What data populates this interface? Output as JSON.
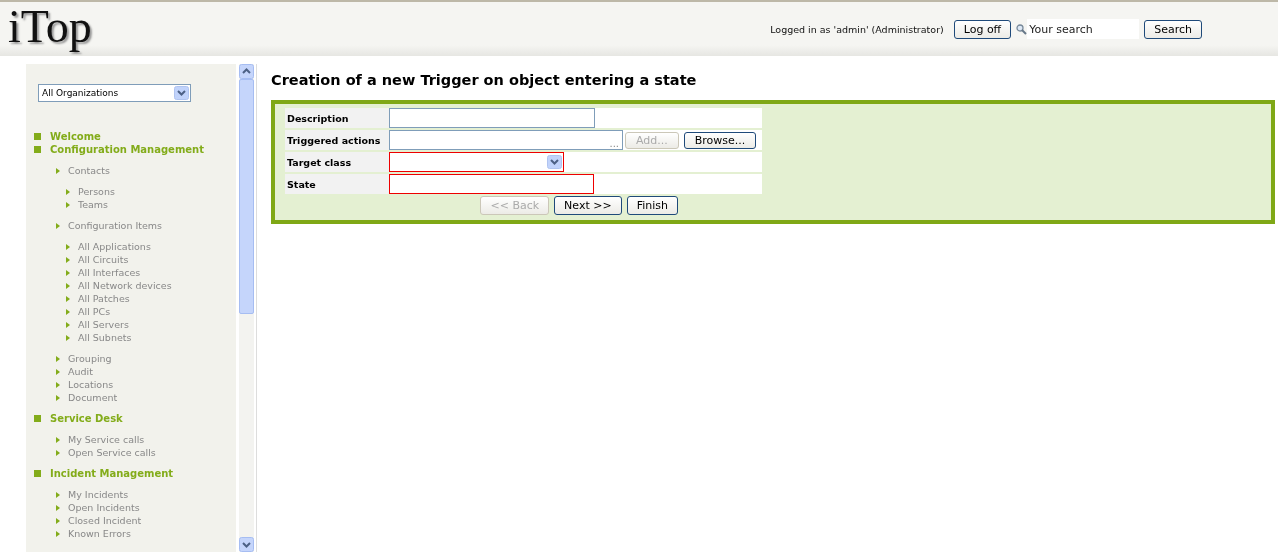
{
  "header": {
    "logo": "iTop",
    "login_text": "Logged in as 'admin' (Administrator)",
    "logoff_button": "Log off",
    "search": {
      "placeholder": "Your search"
    },
    "search_button": "Search"
  },
  "sidebar": {
    "organization_select": "All Organizations",
    "menu": [
      {
        "label": "Welcome"
      },
      {
        "label": "Configuration Management",
        "children": [
          {
            "label": "Contacts",
            "children": [
              {
                "label": "Persons"
              },
              {
                "label": "Teams"
              }
            ]
          },
          {
            "label": "Configuration Items",
            "children": [
              {
                "label": "All Applications"
              },
              {
                "label": "All Circuits"
              },
              {
                "label": "All Interfaces"
              },
              {
                "label": "All Network devices"
              },
              {
                "label": "All Patches"
              },
              {
                "label": "All PCs"
              },
              {
                "label": "All Servers"
              },
              {
                "label": "All Subnets"
              }
            ]
          },
          {
            "label": "Grouping"
          },
          {
            "label": "Audit"
          },
          {
            "label": "Locations"
          },
          {
            "label": "Document"
          }
        ]
      },
      {
        "label": "Service Desk",
        "children": [
          {
            "label": "My Service calls"
          },
          {
            "label": "Open Service calls"
          }
        ]
      },
      {
        "label": "Incident Management",
        "children": [
          {
            "label": "My Incidents"
          },
          {
            "label": "Open Incidents"
          },
          {
            "label": "Closed Incident"
          },
          {
            "label": "Known Errors"
          }
        ]
      }
    ]
  },
  "page": {
    "title": "Creation of a new Trigger on object entering a state",
    "fields": [
      {
        "label": "Description",
        "kind": "text",
        "invalid": false
      },
      {
        "label": "Triggered actions",
        "kind": "lookup",
        "invalid": false,
        "ellipsis": "...",
        "add_button": {
          "label": "Add...",
          "disabled": true
        },
        "browse_button": {
          "label": "Browse...",
          "disabled": false
        }
      },
      {
        "label": "Target class",
        "kind": "select",
        "invalid": true
      },
      {
        "label": "State",
        "kind": "text",
        "invalid": true
      }
    ],
    "buttons": [
      {
        "label": "<< Back",
        "disabled": true
      },
      {
        "label": "Next >>",
        "disabled": false
      },
      {
        "label": "Finish",
        "disabled": false
      }
    ]
  }
}
